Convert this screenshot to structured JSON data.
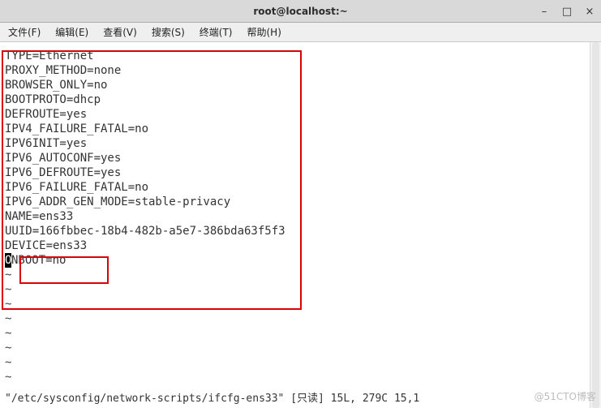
{
  "titlebar": {
    "title": "root@localhost:~"
  },
  "window_controls": {
    "minimize": "–",
    "maximize": "□",
    "close": "×"
  },
  "menu": {
    "file": "文件(F)",
    "edit": "编辑(E)",
    "view": "查看(V)",
    "search": "搜索(S)",
    "terminal": "终端(T)",
    "help": "帮助(H)"
  },
  "file_content": {
    "lines": [
      "TYPE=Ethernet",
      "PROXY_METHOD=none",
      "BROWSER_ONLY=no",
      "BOOTPROTO=dhcp",
      "DEFROUTE=yes",
      "IPV4_FAILURE_FATAL=no",
      "IPV6INIT=yes",
      "IPV6_AUTOCONF=yes",
      "IPV6_DEFROUTE=yes",
      "IPV6_FAILURE_FATAL=no",
      "IPV6_ADDR_GEN_MODE=stable-privacy",
      "NAME=ens33",
      "UUID=166fbbec-18b4-482b-a5e7-386bda63f5f3",
      "DEVICE=ens33"
    ],
    "cursor_line_prefix": "O",
    "cursor_line_rest": "NBOOT=no",
    "tilde": "~"
  },
  "status": {
    "text": "\"/etc/sysconfig/network-scripts/ifcfg-ens33\" [只读] 15L, 279C 15,1"
  },
  "watermark": {
    "text": "@51CTO博客"
  }
}
